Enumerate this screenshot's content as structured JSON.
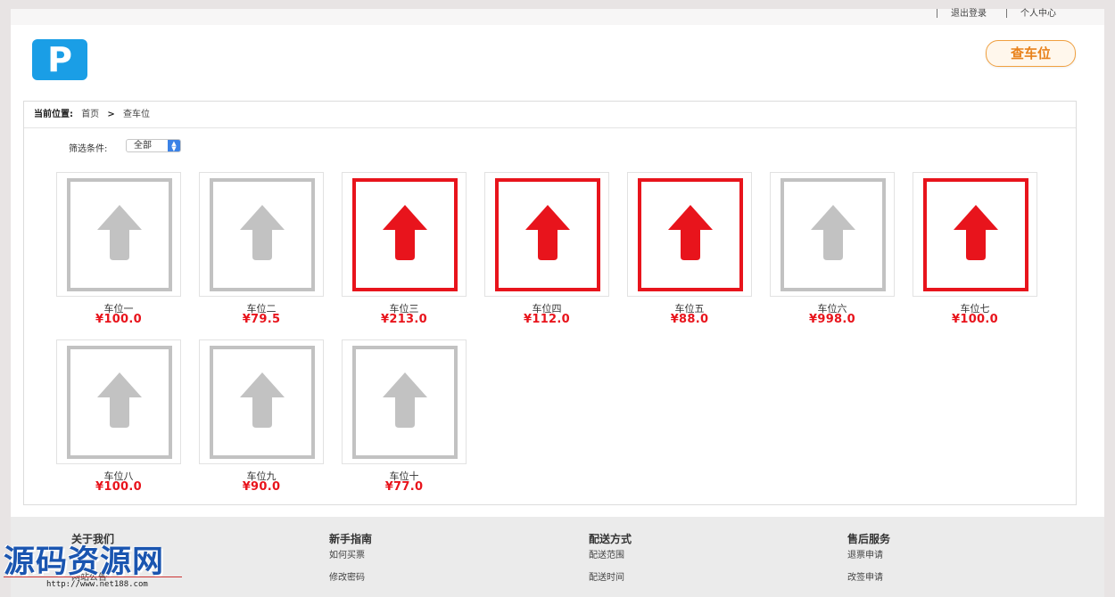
{
  "topbar": {
    "logout": "退出登录",
    "profile": "个人中心"
  },
  "header": {
    "logo_letter": "P",
    "query_button": "查车位"
  },
  "breadcrumb": {
    "label": "当前位置:",
    "home": "首页",
    "separator": ">",
    "current": "查车位"
  },
  "filter": {
    "label": "筛选条件:",
    "selected": "全部"
  },
  "colors": {
    "accent": "#e8141c",
    "available": "#c2c2c2",
    "button": "#e8821c",
    "logo": "#1a9ee6"
  },
  "spots": [
    {
      "name": "车位一",
      "price": "¥100.0",
      "status": "available"
    },
    {
      "name": "车位二",
      "price": "¥79.5",
      "status": "available"
    },
    {
      "name": "车位三",
      "price": "¥213.0",
      "status": "occupied"
    },
    {
      "name": "车位四",
      "price": "¥112.0",
      "status": "occupied"
    },
    {
      "name": "车位五",
      "price": "¥88.0",
      "status": "occupied"
    },
    {
      "name": "车位六",
      "price": "¥998.0",
      "status": "available"
    },
    {
      "name": "车位七",
      "price": "¥100.0",
      "status": "occupied"
    },
    {
      "name": "车位八",
      "price": "¥100.0",
      "status": "available"
    },
    {
      "name": "车位九",
      "price": "¥90.0",
      "status": "available"
    },
    {
      "name": "车位十",
      "price": "¥77.0",
      "status": "available"
    }
  ],
  "footer": {
    "columns": [
      {
        "title": "关于我们",
        "items": [
          "",
          "网站公告"
        ]
      },
      {
        "title": "新手指南",
        "items": [
          "如何买票",
          "修改密码"
        ]
      },
      {
        "title": "配送方式",
        "items": [
          "配送范围",
          "配送时间"
        ]
      },
      {
        "title": "售后服务",
        "items": [
          "退票申请",
          "改签申请"
        ]
      }
    ]
  },
  "watermark": {
    "text": "源码资源网",
    "url": "http://www.net188.com"
  }
}
